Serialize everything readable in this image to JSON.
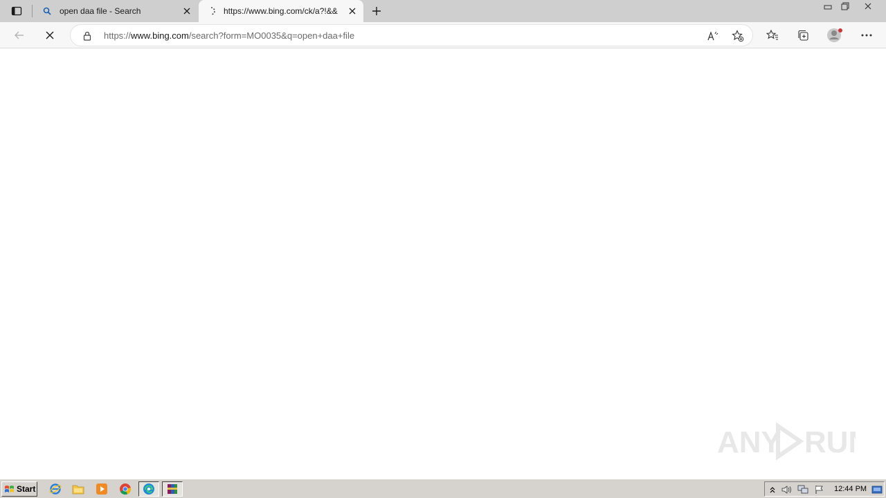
{
  "tabs": [
    {
      "title": "open daa file - Search",
      "icon": "search-icon",
      "active": false
    },
    {
      "title": "https://www.bing.com/ck/a?!&&",
      "icon": "loading-icon",
      "active": true
    }
  ],
  "address": {
    "scheme": "https://",
    "host": "www.bing.com",
    "path": "/search?form=MO0035&q=open+daa+file"
  },
  "watermark": {
    "text": "ANY RUN"
  },
  "taskbar": {
    "start_label": "Start",
    "clock": "12:44 PM",
    "apps": [
      "internet-explorer-icon",
      "file-explorer-icon",
      "media-player-icon",
      "chrome-icon",
      "edge-icon",
      "winrar-icon"
    ]
  },
  "colors": {
    "titlebar": "#cfcfcf",
    "toolbar": "#f7f7f7",
    "taskbar": "#d6d3ce",
    "profile_badge": "#d13438"
  }
}
